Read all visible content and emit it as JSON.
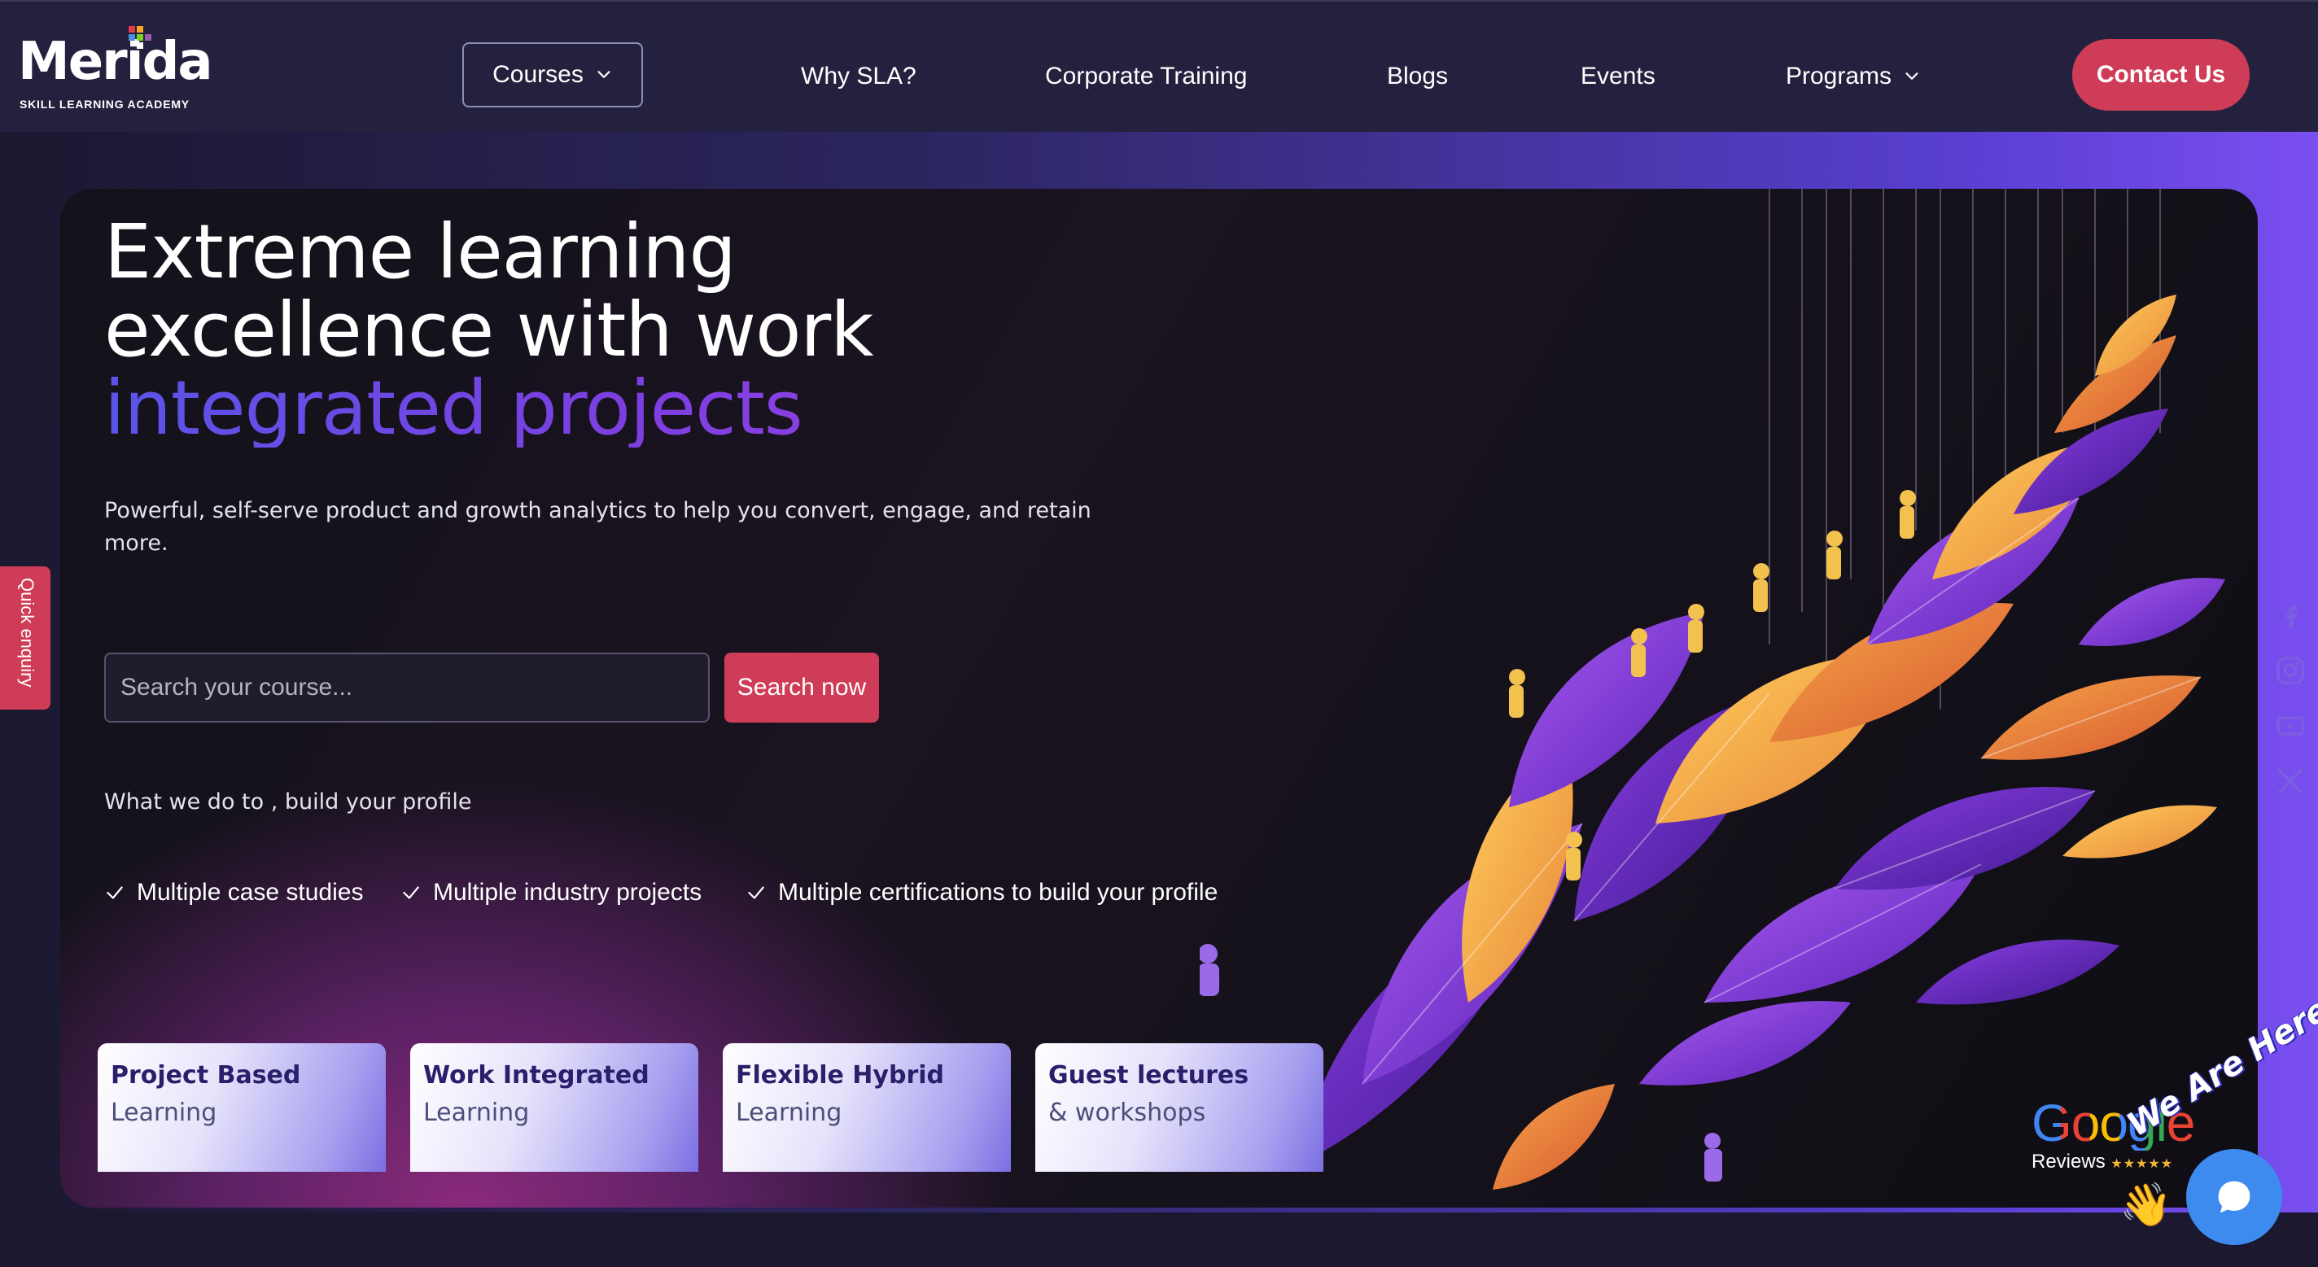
{
  "brand": {
    "name": "Merida",
    "tagline": "SKILL LEARNING ACADEMY"
  },
  "nav": {
    "courses": "Courses",
    "why_sla": "Why SLA?",
    "corporate_training": "Corporate Training",
    "blogs": "Blogs",
    "events": "Events",
    "programs": "Programs",
    "contact": "Contact Us"
  },
  "hero": {
    "headline_line1": "Extreme learning",
    "headline_line2": "excellence with work",
    "headline_accent": "integrated projects",
    "subtext": "Powerful, self-serve product and growth analytics to help you convert, engage, and retain more.",
    "search_placeholder": "Search your course...",
    "search_button": "Search now",
    "what_we_do": "What we do to , build your profile",
    "checks": [
      "Multiple case studies",
      "Multiple industry projects",
      "Multiple certifications to build your profile"
    ],
    "features": [
      {
        "title": "Project Based",
        "sub": "Learning"
      },
      {
        "title": "Work Integrated",
        "sub": "Learning"
      },
      {
        "title": "Flexible Hybrid",
        "sub": "Learning"
      },
      {
        "title": "Guest lectures",
        "sub": "& workshops"
      }
    ]
  },
  "side": {
    "quick_enquiry": "Quick enquiry",
    "social_icons": [
      "facebook-icon",
      "instagram-icon",
      "youtube-icon",
      "x-icon"
    ]
  },
  "widgets": {
    "google_word": "Google",
    "google_reviews": "Reviews",
    "stars": "★★★★★",
    "we_are_here": "We Are Here!"
  },
  "colors": {
    "accent_red": "#cf3c57",
    "header_bg": "#24213f",
    "headline_gradient": [
      "#5a55e8",
      "#9b45e6"
    ],
    "chat_blue": "#3d8bef"
  }
}
